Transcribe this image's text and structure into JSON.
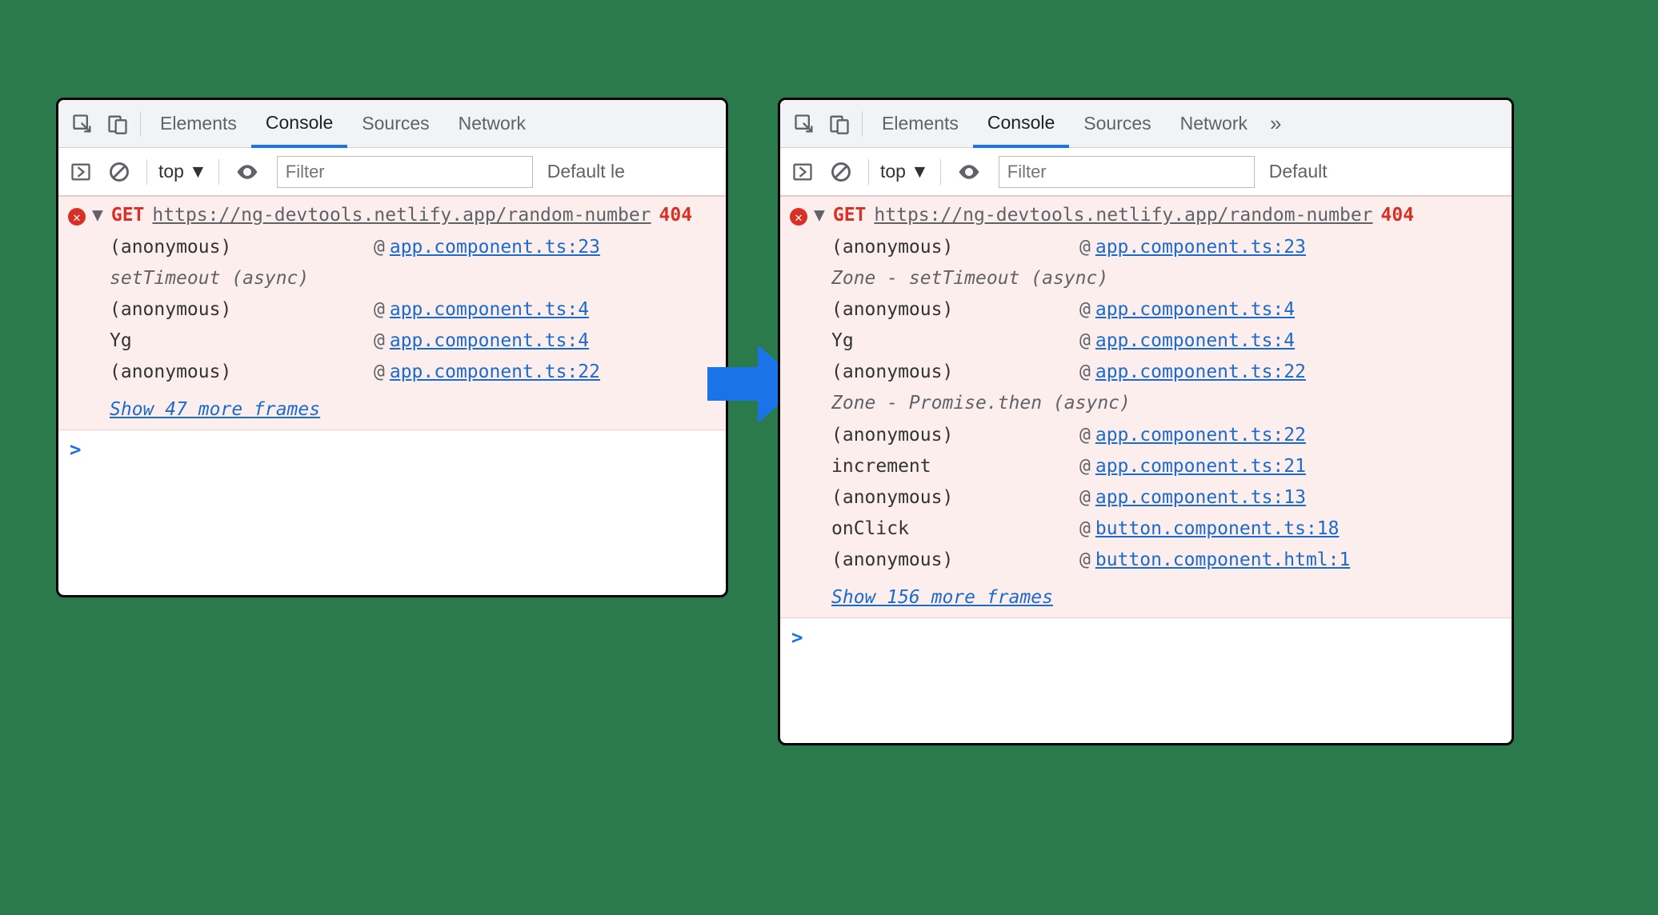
{
  "tabs": {
    "elements": "Elements",
    "console": "Console",
    "sources": "Sources",
    "network": "Network"
  },
  "toolbar": {
    "context": "top",
    "filter_placeholder": "Filter",
    "levels_left": "Default le",
    "levels_right": "Default"
  },
  "error": {
    "method": "GET",
    "url": "https://ng-devtools.netlify.app/random-number",
    "status": "404"
  },
  "left_frames": [
    {
      "fn": "(anonymous)",
      "src": "app.component.ts:23"
    },
    {
      "fn": "setTimeout (async)",
      "italic": true
    },
    {
      "fn": "(anonymous)",
      "src": "app.component.ts:4"
    },
    {
      "fn": "Yg",
      "src": "app.component.ts:4"
    },
    {
      "fn": "(anonymous)",
      "src": "app.component.ts:22"
    }
  ],
  "left_more": "Show 47 more frames",
  "right_frames": [
    {
      "fn": "(anonymous)",
      "src": "app.component.ts:23"
    },
    {
      "fn": "Zone - setTimeout (async)",
      "italic": true
    },
    {
      "fn": "(anonymous)",
      "src": "app.component.ts:4"
    },
    {
      "fn": "Yg",
      "src": "app.component.ts:4"
    },
    {
      "fn": "(anonymous)",
      "src": "app.component.ts:22"
    },
    {
      "fn": "Zone - Promise.then (async)",
      "italic": true
    },
    {
      "fn": "(anonymous)",
      "src": "app.component.ts:22"
    },
    {
      "fn": "increment",
      "src": "app.component.ts:21"
    },
    {
      "fn": "(anonymous)",
      "src": "app.component.ts:13"
    },
    {
      "fn": "onClick",
      "src": "button.component.ts:18"
    },
    {
      "fn": "(anonymous)",
      "src": "button.component.html:1"
    }
  ],
  "right_more": "Show 156 more frames",
  "prompt": ">"
}
